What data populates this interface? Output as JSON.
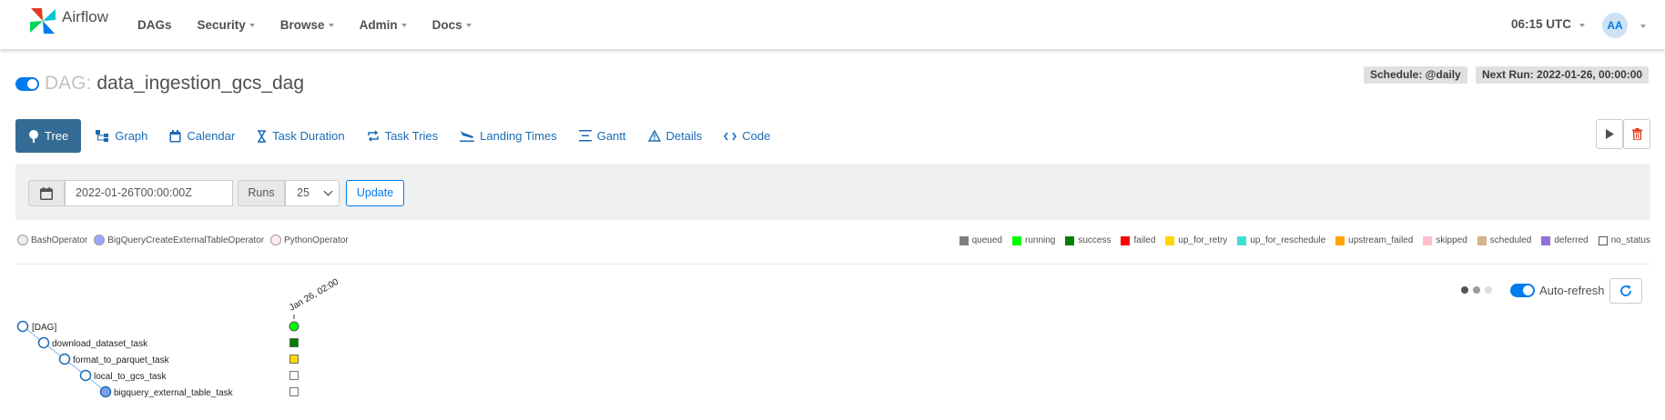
{
  "app": {
    "name": "Airflow"
  },
  "nav": {
    "items": [
      {
        "label": "DAGs",
        "dropdown": false
      },
      {
        "label": "Security",
        "dropdown": true
      },
      {
        "label": "Browse",
        "dropdown": true
      },
      {
        "label": "Admin",
        "dropdown": true
      },
      {
        "label": "Docs",
        "dropdown": true
      }
    ],
    "clock": "06:15 UTC",
    "avatar": "AA"
  },
  "dag": {
    "prefix": "DAG:",
    "name": "data_ingestion_gcs_dag",
    "paused": false,
    "schedule": "Schedule: @daily",
    "next_run": "Next Run: 2022-01-26, 00:00:00"
  },
  "tabs": [
    {
      "label": "Tree",
      "icon": "tree-icon",
      "active": true
    },
    {
      "label": "Graph",
      "icon": "graph-icon",
      "active": false
    },
    {
      "label": "Calendar",
      "icon": "calendar-icon",
      "active": false
    },
    {
      "label": "Task Duration",
      "icon": "hourglass-icon",
      "active": false
    },
    {
      "label": "Task Tries",
      "icon": "repeat-icon",
      "active": false
    },
    {
      "label": "Landing Times",
      "icon": "plane-landing-icon",
      "active": false
    },
    {
      "label": "Gantt",
      "icon": "gantt-icon",
      "active": false
    },
    {
      "label": "Details",
      "icon": "warning-triangle-icon",
      "active": false
    },
    {
      "label": "Code",
      "icon": "code-icon",
      "active": false
    }
  ],
  "filter": {
    "base_date": "2022-01-26T00:00:00Z",
    "runs_label": "Runs",
    "runs_value": "25",
    "update_label": "Update"
  },
  "operators": [
    {
      "label": "BashOperator",
      "color": "#f0ede4"
    },
    {
      "label": "BigQueryCreateExternalTableOperator",
      "color": "#99a8ff"
    },
    {
      "label": "PythonOperator",
      "color": "#ffefeb"
    }
  ],
  "statuses": [
    {
      "label": "queued",
      "color": "#808080"
    },
    {
      "label": "running",
      "color": "#00ff00"
    },
    {
      "label": "success",
      "color": "#008000"
    },
    {
      "label": "failed",
      "color": "#ff0000"
    },
    {
      "label": "up_for_retry",
      "color": "#ffd700"
    },
    {
      "label": "up_for_reschedule",
      "color": "#40e0d0"
    },
    {
      "label": "upstream_failed",
      "color": "#ffa500"
    },
    {
      "label": "skipped",
      "color": "#ffc0cb"
    },
    {
      "label": "scheduled",
      "color": "#d2b48c"
    },
    {
      "label": "deferred",
      "color": "#9370db"
    },
    {
      "label": "no_status",
      "color": "#ffffff"
    }
  ],
  "auto_refresh": {
    "label": "Auto-refresh",
    "enabled": true
  },
  "tree": {
    "run_label": "Jan 26, 02:00",
    "nodes": [
      {
        "label": "[DAG]",
        "status": "running"
      },
      {
        "label": "download_dataset_task",
        "status": "success"
      },
      {
        "label": "format_to_parquet_task",
        "status": "up_for_retry"
      },
      {
        "label": "local_to_gcs_task",
        "status": "no_status"
      },
      {
        "label": "bigquery_external_table_task",
        "status": "no_status"
      }
    ]
  }
}
